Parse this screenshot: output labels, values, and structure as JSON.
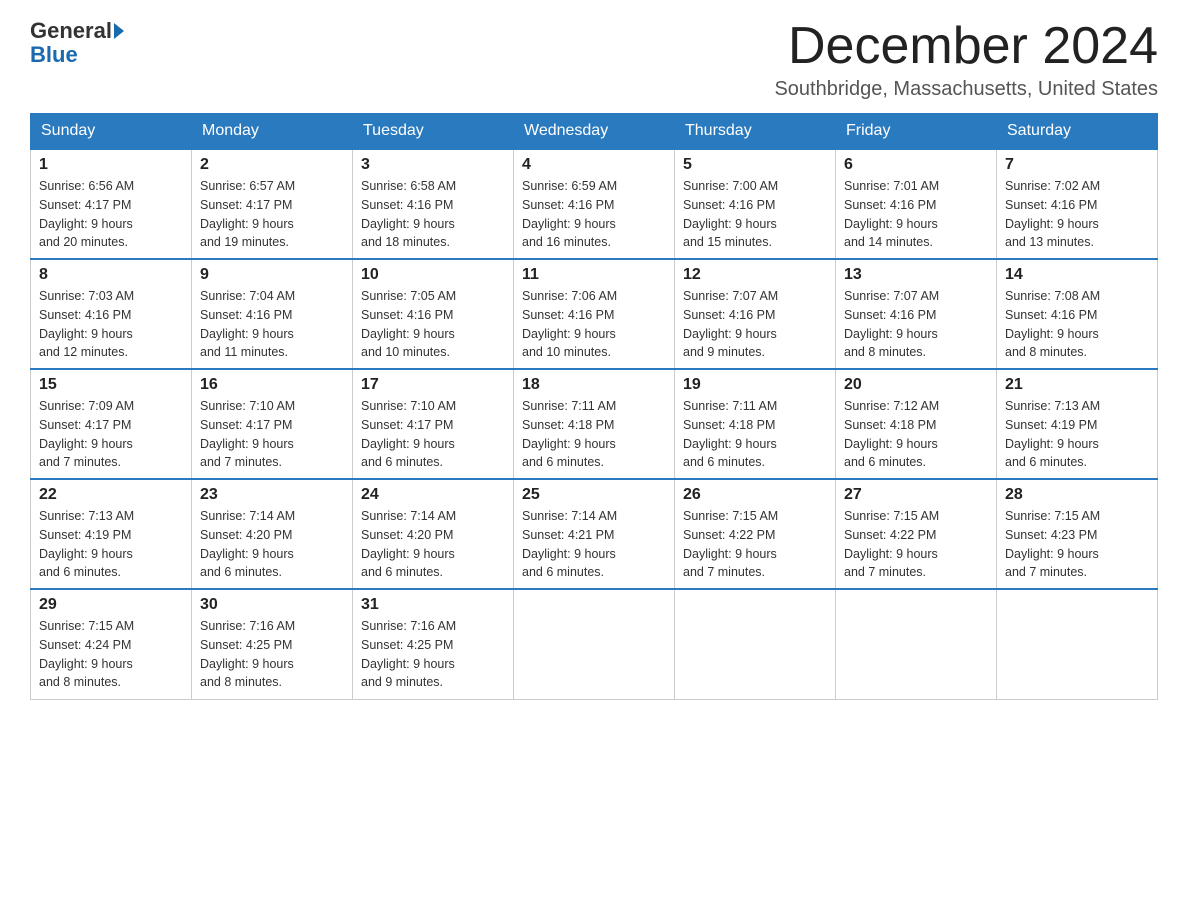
{
  "header": {
    "logo_general": "General",
    "logo_blue": "Blue",
    "month_title": "December 2024",
    "location": "Southbridge, Massachusetts, United States"
  },
  "weekdays": [
    "Sunday",
    "Monday",
    "Tuesday",
    "Wednesday",
    "Thursday",
    "Friday",
    "Saturday"
  ],
  "weeks": [
    [
      {
        "day": "1",
        "sunrise": "6:56 AM",
        "sunset": "4:17 PM",
        "daylight": "9 hours and 20 minutes."
      },
      {
        "day": "2",
        "sunrise": "6:57 AM",
        "sunset": "4:17 PM",
        "daylight": "9 hours and 19 minutes."
      },
      {
        "day": "3",
        "sunrise": "6:58 AM",
        "sunset": "4:16 PM",
        "daylight": "9 hours and 18 minutes."
      },
      {
        "day": "4",
        "sunrise": "6:59 AM",
        "sunset": "4:16 PM",
        "daylight": "9 hours and 16 minutes."
      },
      {
        "day": "5",
        "sunrise": "7:00 AM",
        "sunset": "4:16 PM",
        "daylight": "9 hours and 15 minutes."
      },
      {
        "day": "6",
        "sunrise": "7:01 AM",
        "sunset": "4:16 PM",
        "daylight": "9 hours and 14 minutes."
      },
      {
        "day": "7",
        "sunrise": "7:02 AM",
        "sunset": "4:16 PM",
        "daylight": "9 hours and 13 minutes."
      }
    ],
    [
      {
        "day": "8",
        "sunrise": "7:03 AM",
        "sunset": "4:16 PM",
        "daylight": "9 hours and 12 minutes."
      },
      {
        "day": "9",
        "sunrise": "7:04 AM",
        "sunset": "4:16 PM",
        "daylight": "9 hours and 11 minutes."
      },
      {
        "day": "10",
        "sunrise": "7:05 AM",
        "sunset": "4:16 PM",
        "daylight": "9 hours and 10 minutes."
      },
      {
        "day": "11",
        "sunrise": "7:06 AM",
        "sunset": "4:16 PM",
        "daylight": "9 hours and 10 minutes."
      },
      {
        "day": "12",
        "sunrise": "7:07 AM",
        "sunset": "4:16 PM",
        "daylight": "9 hours and 9 minutes."
      },
      {
        "day": "13",
        "sunrise": "7:07 AM",
        "sunset": "4:16 PM",
        "daylight": "9 hours and 8 minutes."
      },
      {
        "day": "14",
        "sunrise": "7:08 AM",
        "sunset": "4:16 PM",
        "daylight": "9 hours and 8 minutes."
      }
    ],
    [
      {
        "day": "15",
        "sunrise": "7:09 AM",
        "sunset": "4:17 PM",
        "daylight": "9 hours and 7 minutes."
      },
      {
        "day": "16",
        "sunrise": "7:10 AM",
        "sunset": "4:17 PM",
        "daylight": "9 hours and 7 minutes."
      },
      {
        "day": "17",
        "sunrise": "7:10 AM",
        "sunset": "4:17 PM",
        "daylight": "9 hours and 6 minutes."
      },
      {
        "day": "18",
        "sunrise": "7:11 AM",
        "sunset": "4:18 PM",
        "daylight": "9 hours and 6 minutes."
      },
      {
        "day": "19",
        "sunrise": "7:11 AM",
        "sunset": "4:18 PM",
        "daylight": "9 hours and 6 minutes."
      },
      {
        "day": "20",
        "sunrise": "7:12 AM",
        "sunset": "4:18 PM",
        "daylight": "9 hours and 6 minutes."
      },
      {
        "day": "21",
        "sunrise": "7:13 AM",
        "sunset": "4:19 PM",
        "daylight": "9 hours and 6 minutes."
      }
    ],
    [
      {
        "day": "22",
        "sunrise": "7:13 AM",
        "sunset": "4:19 PM",
        "daylight": "9 hours and 6 minutes."
      },
      {
        "day": "23",
        "sunrise": "7:14 AM",
        "sunset": "4:20 PM",
        "daylight": "9 hours and 6 minutes."
      },
      {
        "day": "24",
        "sunrise": "7:14 AM",
        "sunset": "4:20 PM",
        "daylight": "9 hours and 6 minutes."
      },
      {
        "day": "25",
        "sunrise": "7:14 AM",
        "sunset": "4:21 PM",
        "daylight": "9 hours and 6 minutes."
      },
      {
        "day": "26",
        "sunrise": "7:15 AM",
        "sunset": "4:22 PM",
        "daylight": "9 hours and 7 minutes."
      },
      {
        "day": "27",
        "sunrise": "7:15 AM",
        "sunset": "4:22 PM",
        "daylight": "9 hours and 7 minutes."
      },
      {
        "day": "28",
        "sunrise": "7:15 AM",
        "sunset": "4:23 PM",
        "daylight": "9 hours and 7 minutes."
      }
    ],
    [
      {
        "day": "29",
        "sunrise": "7:15 AM",
        "sunset": "4:24 PM",
        "daylight": "9 hours and 8 minutes."
      },
      {
        "day": "30",
        "sunrise": "7:16 AM",
        "sunset": "4:25 PM",
        "daylight": "9 hours and 8 minutes."
      },
      {
        "day": "31",
        "sunrise": "7:16 AM",
        "sunset": "4:25 PM",
        "daylight": "9 hours and 9 minutes."
      },
      null,
      null,
      null,
      null
    ]
  ],
  "labels": {
    "sunrise": "Sunrise: ",
    "sunset": "Sunset: ",
    "daylight": "Daylight: "
  }
}
